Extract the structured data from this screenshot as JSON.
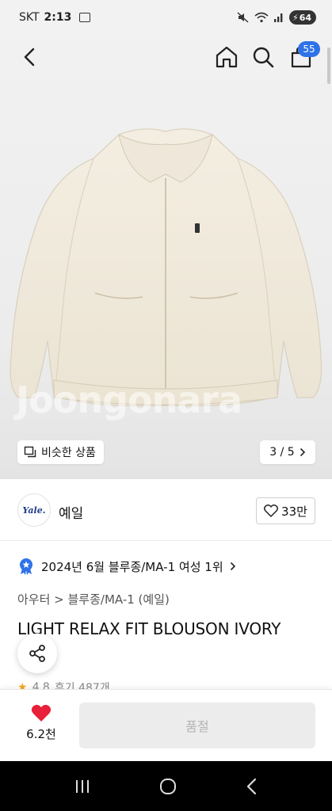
{
  "status_bar": {
    "carrier": "SKT",
    "time": "2:13",
    "battery": "64"
  },
  "header": {
    "cart_count": "55"
  },
  "gallery": {
    "similar_label": "비슷한 상품",
    "page_indicator": "3 / 5",
    "watermark": "Joongonara"
  },
  "brand": {
    "logo_text": "Yale.",
    "name": "예일",
    "likes": "33만"
  },
  "ranking": {
    "text": "2024년 6월 블루종/MA-1 여성 1위"
  },
  "breadcrumb": {
    "path": "아우터 > 블루종/MA-1 (예일)"
  },
  "product": {
    "title": "LIGHT RELAX FIT BLOUSON IVORY",
    "rating": "4.8",
    "reviews": "후기 487개"
  },
  "buy_bar": {
    "wish_count": "6.2천",
    "soldout_label": "품절"
  },
  "colors": {
    "accent": "#2f72e8",
    "heart": "#e8203a",
    "jacket": "#f1ebdd"
  }
}
